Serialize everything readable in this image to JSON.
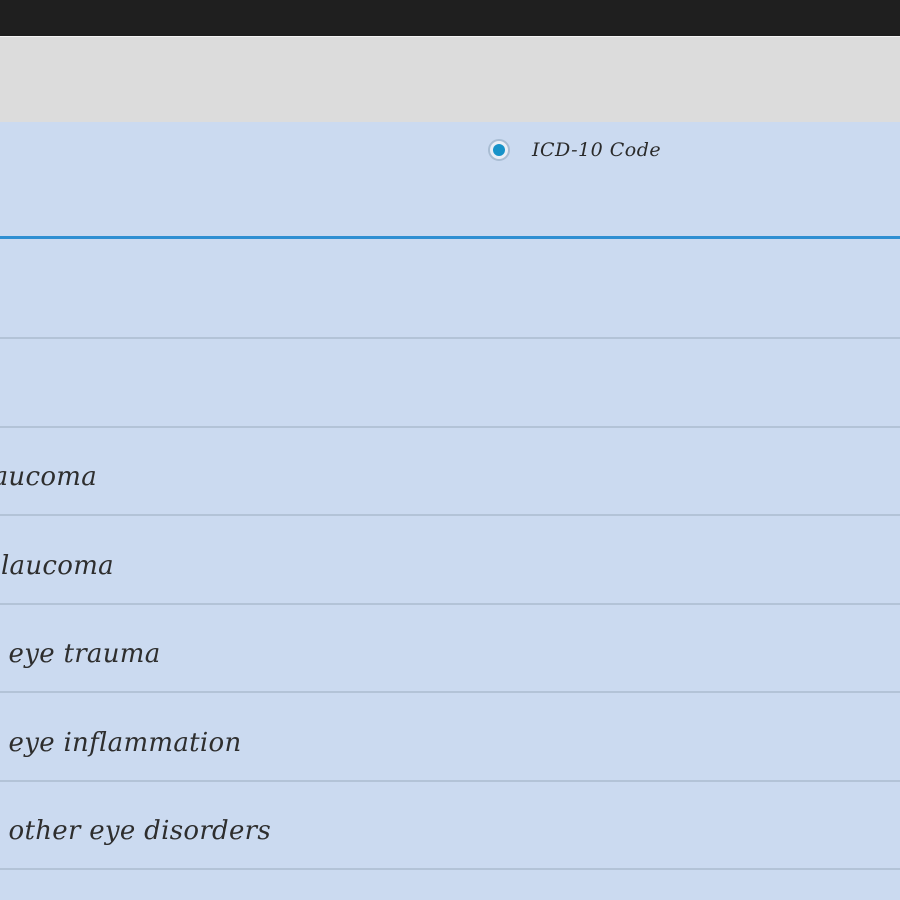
{
  "filter": {
    "radio_label": "ICD-10 Code",
    "radio_selected": true,
    "accent_color": "#1893c9"
  },
  "results": [
    {
      "label": ""
    },
    {
      "label": ""
    },
    {
      "label": "laucoma"
    },
    {
      "label": "glaucoma"
    },
    {
      "label": "o eye trauma"
    },
    {
      "label": "o eye inflammation"
    },
    {
      "label": "o other eye disorders"
    },
    {
      "label": ""
    }
  ]
}
